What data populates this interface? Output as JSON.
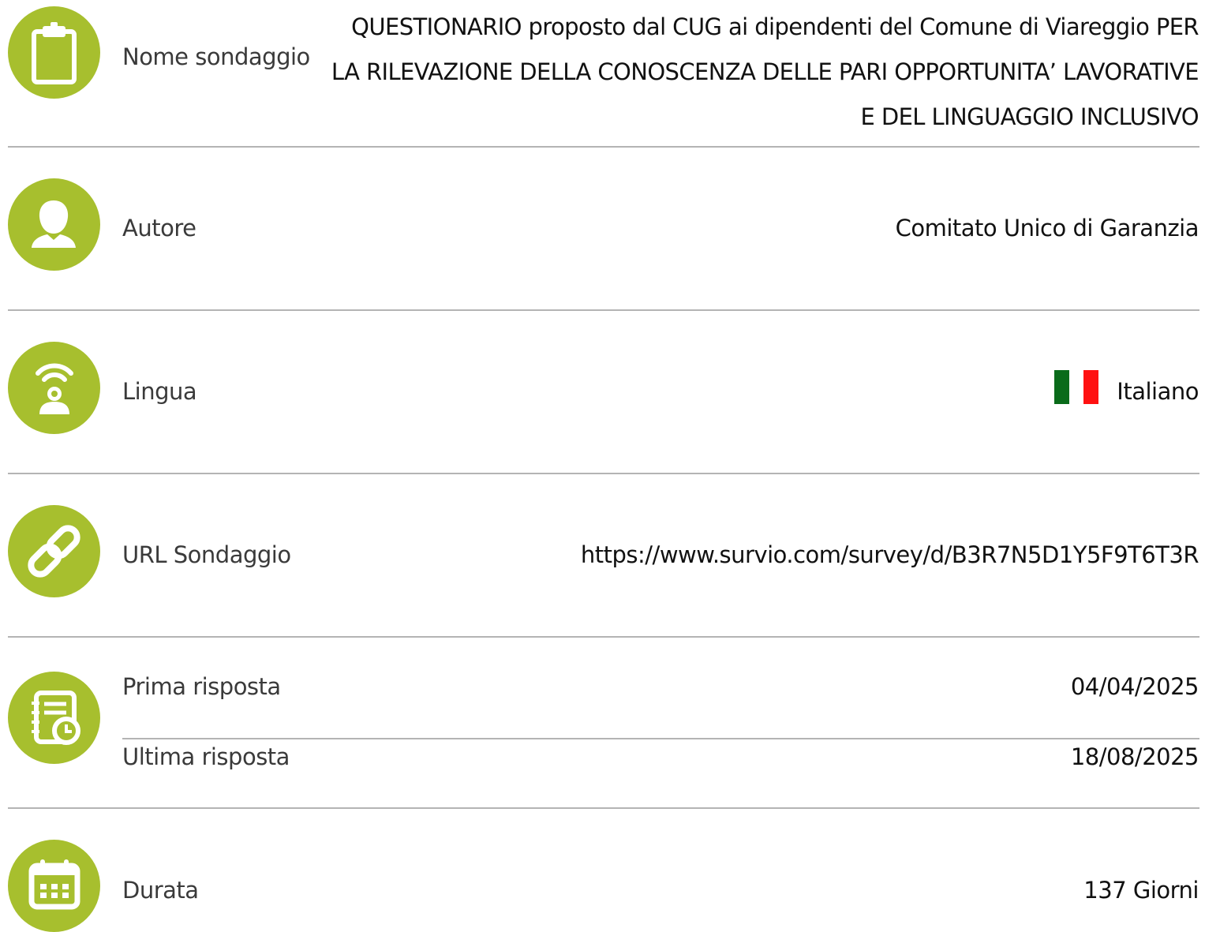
{
  "colors": {
    "icon_background": "#a7bf2e",
    "divider": "#b4b4b4",
    "flag_green": "#0a6b1a",
    "flag_red": "#ff1111"
  },
  "survey_name": {
    "icon": "clipboard-icon",
    "label": "Nome sondaggio",
    "value": "QUESTIONARIO proposto dal CUG ai dipendenti del Comune di Viareggio PER LA RILEVAZIONE DELLA CONOSCENZA DELLE PARI OPPORTUNITA’ LAVORATIVE E DEL LINGUAGGIO INCLUSIVO"
  },
  "author": {
    "icon": "user-icon",
    "label": "Autore",
    "value": "Comitato Unico di Garanzia"
  },
  "language": {
    "icon": "language-icon",
    "label": "Lingua",
    "flag": "italian-flag-icon",
    "value": "Italiano"
  },
  "url": {
    "icon": "link-icon",
    "label": "URL Sondaggio",
    "value": "https://www.survio.com/survey/d/B3R7N5D1Y5F9T6T3R"
  },
  "responses": {
    "icon": "responses-icon",
    "first_label": "Prima risposta",
    "first_value": "04/04/2025",
    "last_label": "Ultima risposta",
    "last_value": "18/08/2025"
  },
  "duration": {
    "icon": "calendar-icon",
    "label": "Durata",
    "value": "137 Giorni"
  }
}
